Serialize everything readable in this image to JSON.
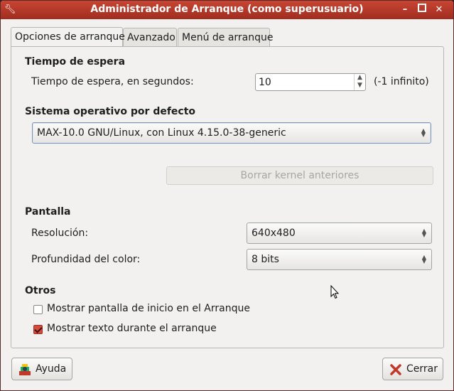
{
  "window": {
    "title": "Administrador de Arranque (como superusuario)",
    "controls": [
      "minimize",
      "maximize",
      "close"
    ]
  },
  "tabs": [
    {
      "label": "Opciones de arranque",
      "active": true
    },
    {
      "label": "Avanzado",
      "active": false
    },
    {
      "label": "Menú de arranque",
      "active": false
    }
  ],
  "timeout": {
    "section_title": "Tiempo de espera",
    "label": "Tiempo de espera, en segundos:",
    "value": "10",
    "hint": "(-1 infinito)"
  },
  "default_os": {
    "section_title": "Sistema operativo por defecto",
    "selected": "MAX-10.0 GNU/Linux, con Linux 4.15.0-38-generic",
    "delete_old_kernels_label": "Borrar kernel anteriores"
  },
  "display": {
    "section_title": "Pantalla",
    "resolution_label": "Resolución:",
    "resolution_value": "640x480",
    "color_depth_label": "Profundidad del color:",
    "color_depth_value": "8 bits"
  },
  "others": {
    "section_title": "Otros",
    "options": [
      {
        "label": "Mostrar pantalla de inicio en el Arranque",
        "checked": false
      },
      {
        "label": "Mostrar texto durante el arranque",
        "checked": true
      }
    ]
  },
  "footer": {
    "help_label": "Ayuda",
    "close_label": "Cerrar"
  },
  "colors": {
    "titlebar": "#b8392a",
    "checkbox_checked": "#d64b3a",
    "window_bg": "#f2f1f0"
  }
}
